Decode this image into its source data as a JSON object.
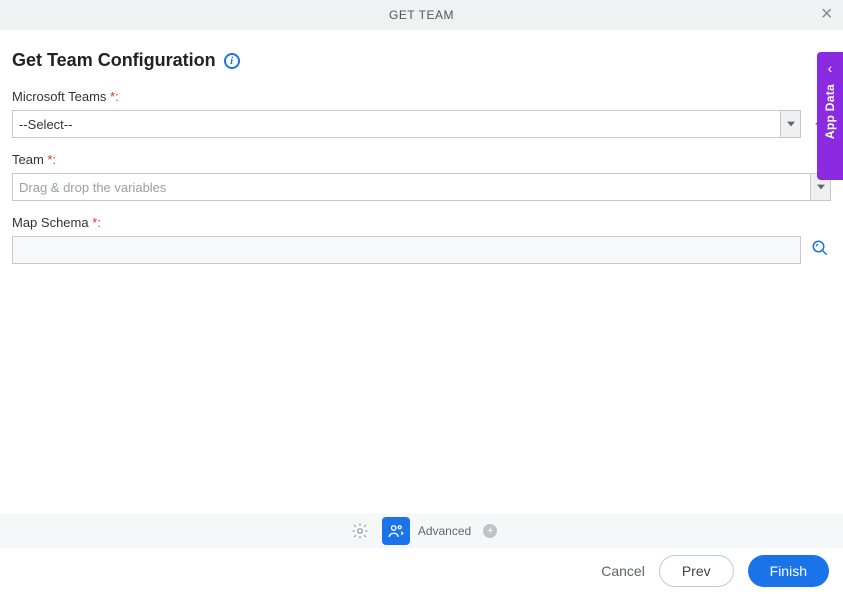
{
  "header": {
    "title": "GET TEAM"
  },
  "page": {
    "title": "Get Team Configuration"
  },
  "fields": {
    "teams": {
      "label": "Microsoft Teams",
      "required_suffix": "*:",
      "value": "--Select--"
    },
    "team": {
      "label": "Team",
      "required_suffix": "*:",
      "placeholder": "Drag & drop the variables"
    },
    "schema": {
      "label": "Map Schema",
      "required_suffix": "*:"
    }
  },
  "side": {
    "label": "App Data"
  },
  "toolbar": {
    "advanced": "Advanced"
  },
  "footer": {
    "cancel": "Cancel",
    "prev": "Prev",
    "finish": "Finish"
  }
}
